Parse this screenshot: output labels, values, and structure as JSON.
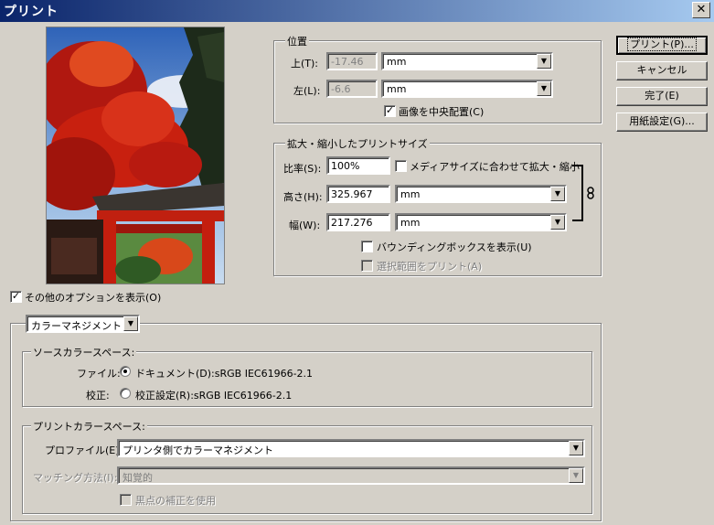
{
  "window": {
    "title": "プリント",
    "close_glyph": "✕"
  },
  "buttons": {
    "print": "プリント(P)...",
    "cancel": "キャンセル",
    "done": "完了(E)",
    "page_setup": "用紙設定(G)..."
  },
  "position": {
    "legend": "位置",
    "top_label": "上(T):",
    "top_value": "-17.46",
    "top_unit": "mm",
    "left_label": "左(L):",
    "left_value": "-6.6",
    "left_unit": "mm",
    "center_label": "画像を中央配置(C)",
    "center_checked": true
  },
  "scaled": {
    "legend": "拡大・縮小したプリントサイズ",
    "scale_label": "比率(S):",
    "scale_value": "100%",
    "fit_media_label": "メディアサイズに合わせて拡大・縮小",
    "fit_media_checked": false,
    "height_label": "高さ(H):",
    "height_value": "325.967",
    "height_unit": "mm",
    "width_label": "幅(W):",
    "width_value": "217.276",
    "width_unit": "mm",
    "bbox_label": "バウンディングボックスを表示(U)",
    "bbox_checked": false,
    "print_selection_label": "選択範囲をプリント(A)",
    "print_selection_checked": false,
    "link_icon": "link-icon"
  },
  "more_options": {
    "label": "その他のオプションを表示(O)",
    "checked": true
  },
  "color_mgmt": {
    "dropdown_value": "カラーマネジメント",
    "source": {
      "legend": "ソースカラースペース:",
      "file_label": "ファイル:",
      "document_option": "ドキュメント(D):sRGB IEC61966-2.1",
      "document_selected": true,
      "proof_label": "校正:",
      "proof_option": "校正設定(R):sRGB IEC61966-2.1",
      "proof_selected": false
    },
    "print_space": {
      "legend": "プリントカラースペース:",
      "profile_label": "プロファイル(E):",
      "profile_value": "プリンタ側でカラーマネジメント",
      "intent_label": "マッチング方法(I):",
      "intent_value": "知覚的",
      "bpc_label": "黒点の補正を使用",
      "bpc_checked": false
    }
  },
  "colors": {
    "title_start": "#0a246a",
    "title_end": "#a6caf0",
    "face": "#d4d0c8"
  }
}
